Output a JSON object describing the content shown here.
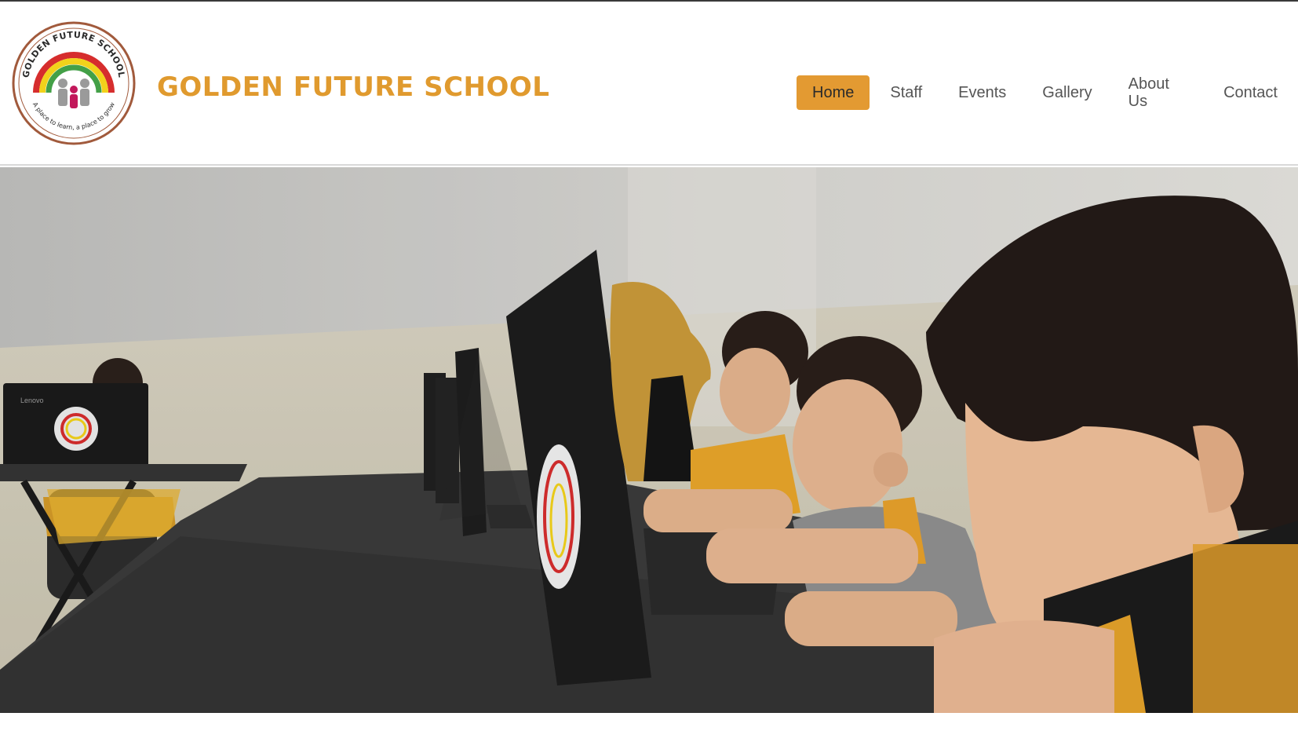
{
  "site": {
    "title": "GOLDEN FUTURE SCHOOL",
    "logo_arc_text": "GOLDEN FUTURE SCHOOL",
    "logo_tagline": "A place to learn, a place to grow",
    "brand_color": "#e09a2e"
  },
  "nav": {
    "items": [
      {
        "label": "Home",
        "active": true
      },
      {
        "label": "Staff",
        "active": false
      },
      {
        "label": "Events",
        "active": false
      },
      {
        "label": "Gallery",
        "active": false
      },
      {
        "label": "About Us",
        "active": false
      },
      {
        "label": "Contact",
        "active": false
      }
    ],
    "active_color": "#e39a32"
  },
  "hero": {
    "laptop_brand": "Lenovo"
  }
}
